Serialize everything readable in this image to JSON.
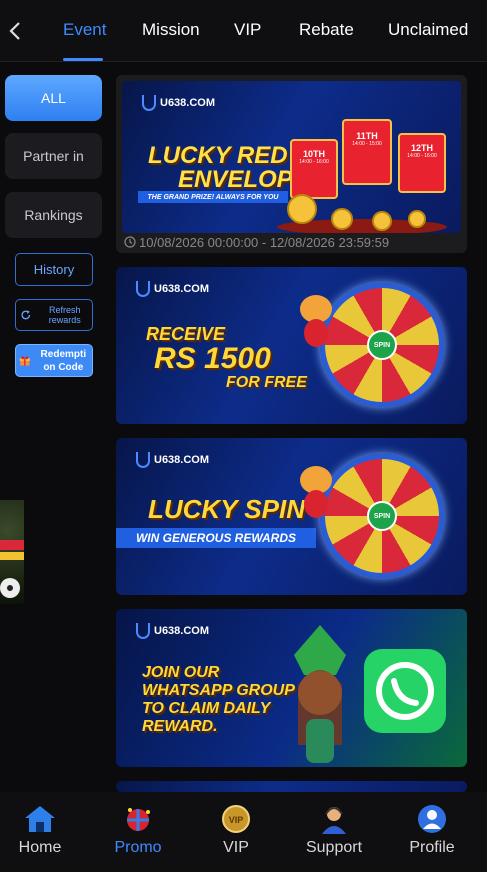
{
  "header": {
    "tabs": [
      {
        "label": "Event",
        "active": true
      },
      {
        "label": "Mission"
      },
      {
        "label": "VIP"
      },
      {
        "label": "Rebate"
      },
      {
        "label": "Unclaimed"
      }
    ]
  },
  "sidebar": {
    "categories": [
      {
        "label": "ALL",
        "active": true
      },
      {
        "label": "Partner in"
      },
      {
        "label": "Rankings"
      }
    ],
    "history_label": "History",
    "refresh_label": "Refresh rewards",
    "redeem_label": "Redempti on Code"
  },
  "banners": [
    {
      "brand": "U638.COM",
      "title_line1": "LUCKY RED",
      "title_line2": "ENVELOPE",
      "ribbon": "THE GRAND PRIZE! ALWAYS FOR YOU",
      "envelopes": [
        {
          "day": "10TH",
          "time": "14:00 - 16:00"
        },
        {
          "day": "11TH",
          "time": "14:00 - 15:00"
        },
        {
          "day": "12TH",
          "time": "14:00 - 16:00"
        }
      ],
      "period": "10/08/2026 00:00:00 - 12/08/2026 23:59:59"
    },
    {
      "brand": "U638.COM",
      "line1": "RECEIVE",
      "line2": "RS 1500",
      "line3": "FOR FREE",
      "wheel_hub": "SPIN"
    },
    {
      "brand": "U638.COM",
      "title": "LUCKY SPIN",
      "subtitle": "WIN GENEROUS REWARDS",
      "wheel_hub": "SPIN"
    },
    {
      "brand": "U638.COM",
      "line1": "JOIN OUR",
      "line2": "WHATSAPP GROUP",
      "line3": "TO CLAIM DAILY",
      "line4": "REWARD."
    }
  ],
  "bottom_nav": [
    {
      "label": "Home",
      "icon": "home-icon"
    },
    {
      "label": "Promo",
      "icon": "promo-icon",
      "active": true
    },
    {
      "label": "VIP",
      "icon": "vip-medal-icon"
    },
    {
      "label": "Support",
      "icon": "support-agent-icon"
    },
    {
      "label": "Profile",
      "icon": "profile-icon"
    }
  ],
  "colors": {
    "accent": "#3d8bff",
    "background": "#0b0b0d",
    "headline_yellow": "#ffd83a"
  }
}
